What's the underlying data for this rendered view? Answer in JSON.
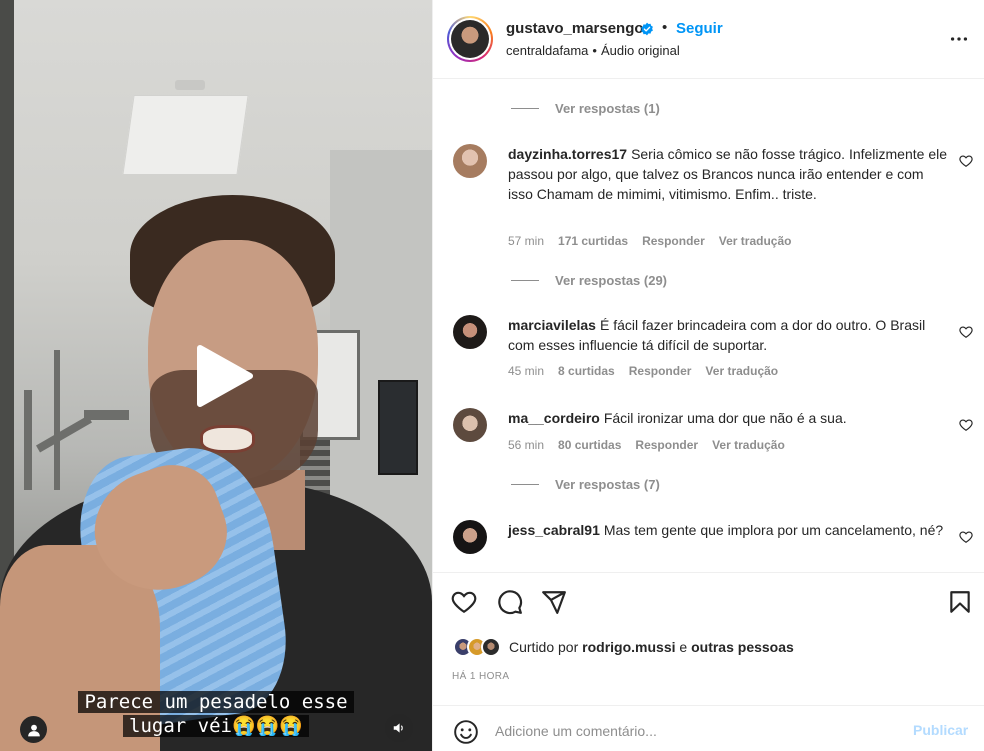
{
  "video": {
    "caption_line1": "Parece um pesadelo esse",
    "caption_line2": "lugar véi😭😭😭",
    "play_icon": "play-icon",
    "user_icon": "user-icon",
    "sound_icon": "sound-icon"
  },
  "header": {
    "username": "gustavo_marsengo",
    "verified": true,
    "separator": "•",
    "follow_label": "Seguir",
    "sub_account": "centraldafama",
    "sub_separator": "•",
    "audio_label": "Áudio original",
    "accent": "#0095f6"
  },
  "comments": {
    "view_replies_1": "Ver respostas (1)",
    "items": [
      {
        "username": "dayzinha.torres17",
        "text": "Seria cômico se não fosse trágico. Infelizmente ele passou por algo, que talvez os Brancos nunca irão entender e com isso Chamam de mimimi, vitimismo. Enfim.. triste.",
        "time": "57 min",
        "likes": "171 curtidas",
        "reply": "Responder",
        "translate": "Ver tradução",
        "view_replies": "Ver respostas (29)"
      },
      {
        "username": "marciavilelas",
        "text": "É fácil fazer brincadeira com a dor do outro. O Brasil com esses influencie tá difícil de suportar.",
        "time": "45 min",
        "likes": "8 curtidas",
        "reply": "Responder",
        "translate": "Ver tradução"
      },
      {
        "username": "ma__cordeiro",
        "text": "Fácil ironizar uma dor que não é a sua.",
        "time": "56 min",
        "likes": "80 curtidas",
        "reply": "Responder",
        "translate": "Ver tradução",
        "view_replies": "Ver respostas (7)"
      },
      {
        "username": "jess_cabral91",
        "text": "Mas tem gente que implora por um cancelamento, né?"
      }
    ]
  },
  "actions": {
    "like_icon": "heart-icon",
    "comment_icon": "comment-icon",
    "share_icon": "send-icon",
    "save_icon": "bookmark-icon",
    "liked_prefix": "Curtido por",
    "liked_user": "rodrigo.mussi",
    "liked_mid": "e",
    "liked_others": "outras pessoas",
    "time_ago": "HÁ 1 HORA",
    "comment_placeholder": "Adicione um comentário...",
    "publish_label": "Publicar",
    "publish_color": "#b3dbff"
  }
}
